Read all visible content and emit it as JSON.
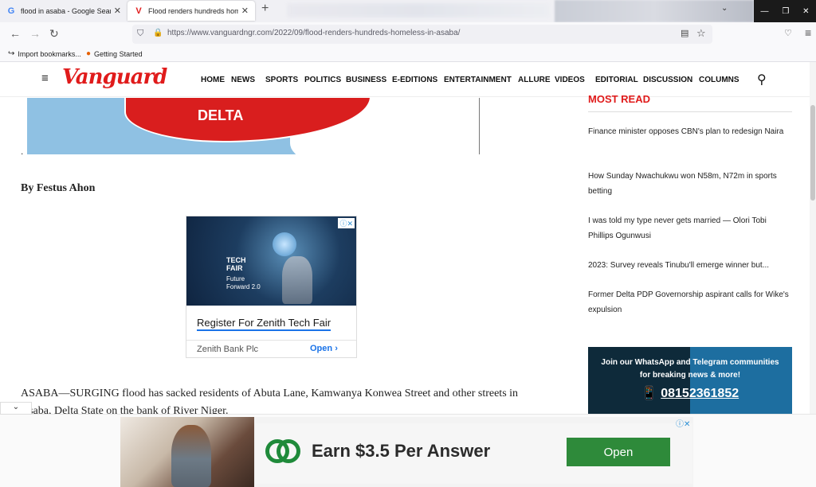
{
  "browser": {
    "tabs": [
      {
        "title": "flood in asaba - Google Search",
        "favicon": "G"
      },
      {
        "title": "Flood renders hundreds homeless-in-asaba",
        "favicon": "V"
      }
    ],
    "close_glyph": "✕",
    "new_tab_glyph": "+",
    "tab_list_glyph": "⌄",
    "url": "https://www.vanguardngr.com/2022/09/flood-renders-hundreds-homeless-in-asaba/",
    "back_glyph": "←",
    "forward_glyph": "→",
    "reload_glyph": "↻",
    "shield_glyph": "⛉",
    "lock_glyph": "🔒",
    "reader_glyph": "▤",
    "star_glyph": "☆",
    "pocket_glyph": "♡",
    "menu_glyph": "≡",
    "window_minimize": "—",
    "window_restore": "❐",
    "window_close": "✕",
    "bookmarks": [
      {
        "label": "Import bookmarks...",
        "icon": "↪"
      },
      {
        "label": "Getting Started",
        "icon": "●"
      }
    ]
  },
  "site": {
    "logo": "Vanguard",
    "hamburger_glyph": "≡",
    "search_glyph": "⚲",
    "nav": [
      "HOME",
      "NEWS",
      "SPORTS",
      "POLITICS",
      "BUSINESS",
      "E-EDITIONS",
      "ENTERTAINMENT",
      "ALLURE",
      "VIDEOS",
      "EDITORIAL",
      "DISCUSSION",
      "COLUMNS"
    ]
  },
  "article": {
    "hero_label": "DELTA",
    "dot": ".",
    "byline": "By Festus Ahon",
    "body": "ASABA—SURGING flood has sacked residents of Abuta Lane, Kamwanya Konwea Street and other streets in Asaba, Delta State on the bank of River Niger."
  },
  "inline_ad": {
    "brand_line1": "TECH",
    "brand_line2": "FAIR",
    "tagline_1": "Future",
    "tagline_2": "Forward 2.0",
    "headline": "Register For Zenith Tech Fair",
    "sponsor": "Zenith Bank Plc",
    "cta": "Open",
    "cta_glyph": "›",
    "adchoice": "ⓘ✕"
  },
  "sidebar": {
    "heading": "MOST READ",
    "items": [
      "Finance minister opposes CBN's plan to redesign Naira",
      "How Sunday Nwachukwu won N58m, N72m in sports betting",
      "I was told my type never gets married — Olori Tobi Phillips Ogunwusi",
      "2023: Survey reveals Tinubu'll emerge winner but...",
      "Former Delta PDP Governorship aspirant calls for Wike's expulsion"
    ],
    "promo_line1": "Join our WhatsApp and Telegram communities",
    "promo_line2": "for breaking news & more!",
    "promo_phone_glyph": "📱",
    "promo_phone": "08152361852"
  },
  "bottom_ad": {
    "headline": "Earn $3.5 Per Answer",
    "cta": "Open",
    "collapse_glyph": "⌄",
    "adchoice": "ⓘ✕"
  }
}
